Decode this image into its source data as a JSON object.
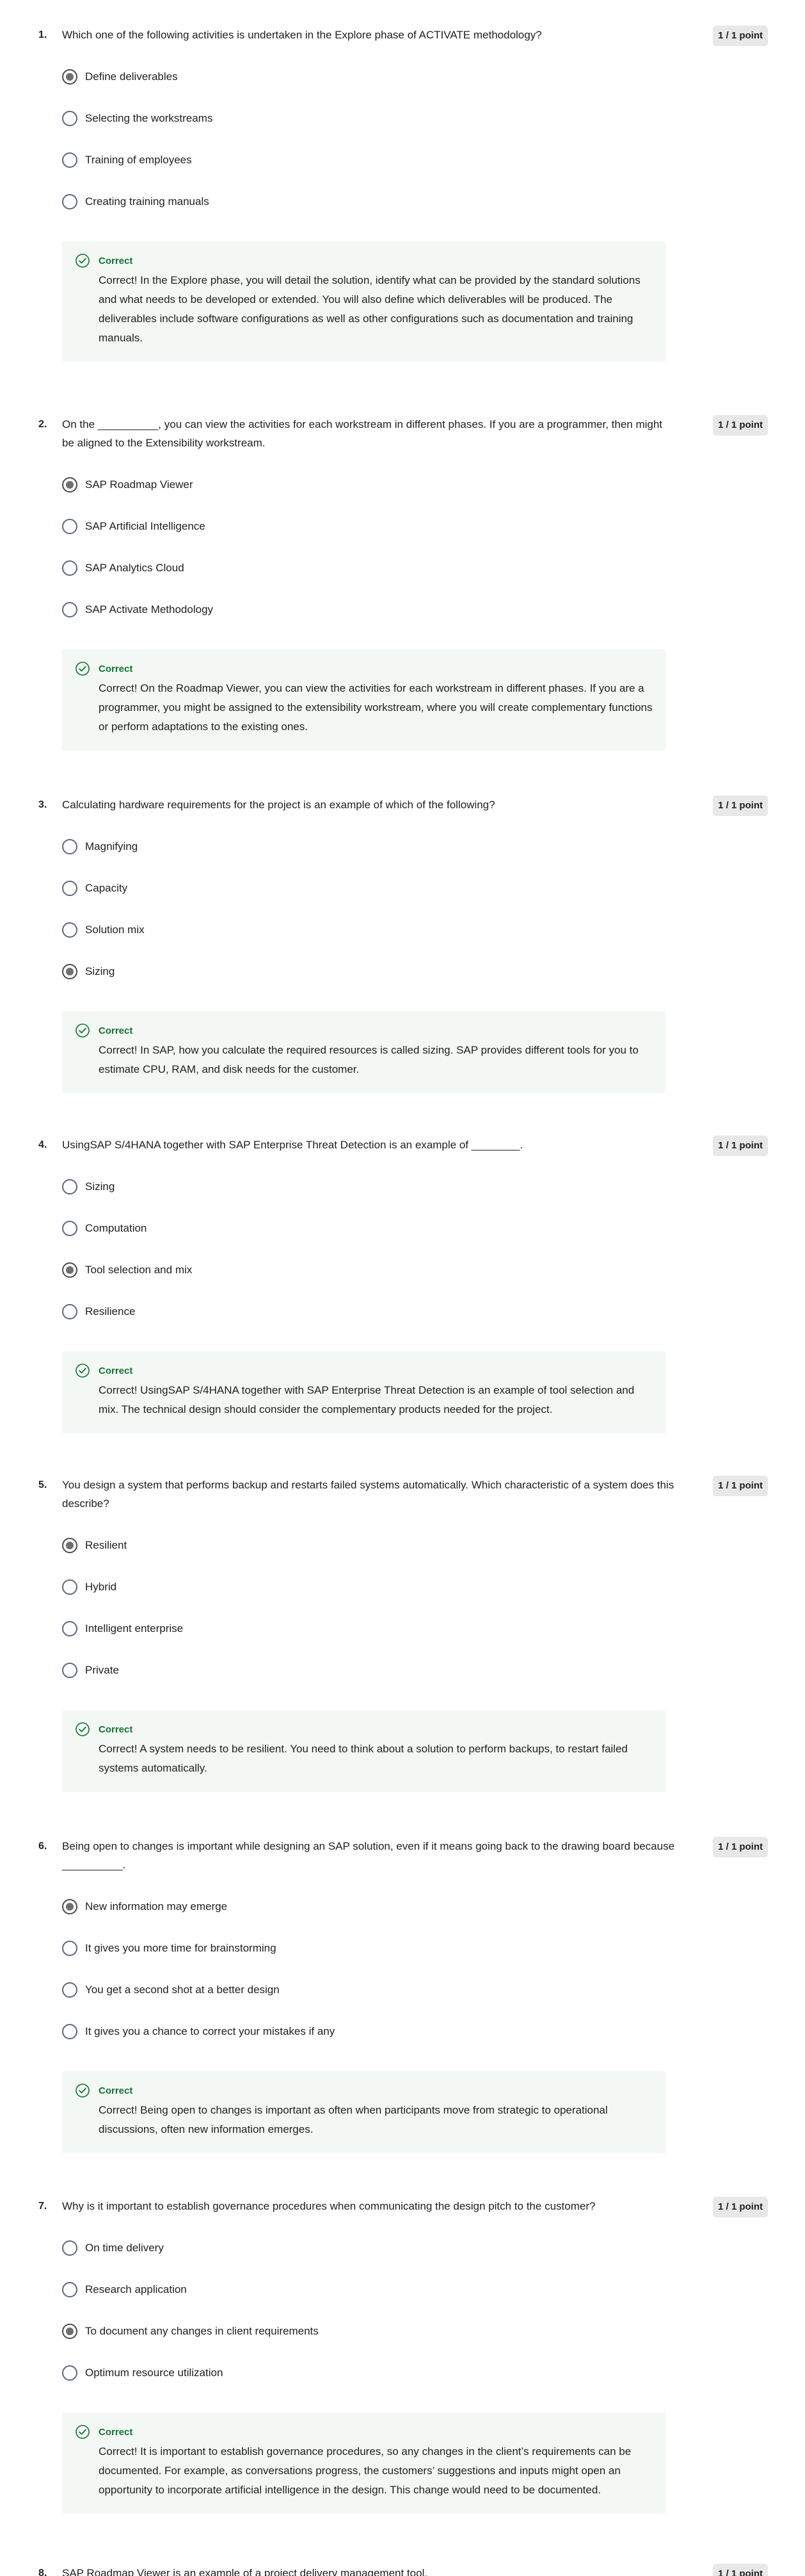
{
  "questions": [
    {
      "number": "1.",
      "text": "Which one of the following activities is undertaken in the Explore phase of ACTIVATE methodology?",
      "points": "1 / 1 point",
      "options": [
        "Define deliverables",
        "Selecting the workstreams",
        "Training of employees",
        "Creating training manuals"
      ],
      "selected": 0,
      "feedback_title": "Correct",
      "feedback_text": "Correct! In the Explore phase, you will detail the solution, identify what can be provided by the standard solutions and what needs to be developed or extended. You will also define which deliverables will be produced. The deliverables include software configurations as well as other configurations such as documentation and training manuals."
    },
    {
      "number": "2.",
      "text": "On the __________, you can view the activities for each workstream in different phases. If you are a programmer, then might be aligned to the Extensibility workstream.",
      "points": "1 / 1 point",
      "options": [
        "SAP Roadmap Viewer",
        "SAP Artificial Intelligence",
        "SAP Analytics Cloud",
        "SAP Activate Methodology"
      ],
      "selected": 0,
      "feedback_title": "Correct",
      "feedback_text": "Correct! On the Roadmap Viewer, you can view the activities for each workstream in different phases. If you are a programmer, you might be assigned to the extensibility workstream, where you will create complementary functions or perform adaptations to the existing ones."
    },
    {
      "number": "3.",
      "text": "Calculating hardware requirements for the project is an example of which of the following?",
      "points": "1 / 1 point",
      "options": [
        "Magnifying",
        "Capacity",
        "Solution mix",
        "Sizing"
      ],
      "selected": 3,
      "feedback_title": "Correct",
      "feedback_text": "Correct! In SAP, how you calculate the required resources is called sizing. SAP provides different tools for you to estimate CPU, RAM, and disk needs for the customer."
    },
    {
      "number": "4.",
      "text": "UsingSAP S/4HANA together with SAP Enterprise Threat Detection is an example of ________.",
      "points": "1 / 1 point",
      "options": [
        "Sizing",
        "Computation",
        "Tool selection and mix",
        "Resilience"
      ],
      "selected": 2,
      "feedback_title": "Correct",
      "feedback_text": "Correct! UsingSAP S/4HANA together with SAP Enterprise Threat Detection is an example of tool selection and mix. The technical design should consider the complementary products needed for the project."
    },
    {
      "number": "5.",
      "text": "You design a system that performs backup and restarts failed systems automatically. Which characteristic of a system does this describe?",
      "points": "1 / 1 point",
      "options": [
        "Resilient",
        "Hybrid",
        "Intelligent enterprise",
        "Private"
      ],
      "selected": 0,
      "feedback_title": "Correct",
      "feedback_text": "Correct! A system needs to be resilient. You need to think about a solution to perform backups, to restart failed systems automatically."
    },
    {
      "number": "6.",
      "text": "Being open to changes is important while designing an SAP solution, even if it means going back to the drawing board because __________.",
      "points": "1 / 1 point",
      "options": [
        "New information may emerge",
        "It gives you more time for brainstorming",
        "You get a second shot at a better design",
        "It gives you a chance to correct your mistakes if any"
      ],
      "selected": 0,
      "feedback_title": "Correct",
      "feedback_text": "Correct! Being open to changes is important as often when participants move from strategic to operational discussions, often new information emerges."
    },
    {
      "number": "7.",
      "text": "Why is it important to establish governance procedures when communicating the design pitch to the customer?",
      "points": "1 / 1 point",
      "options": [
        "On time delivery",
        "Research application",
        "To document any changes in client requirements",
        "Optimum resource utilization"
      ],
      "selected": 2,
      "feedback_title": "Correct",
      "feedback_text": "Correct! It is important to establish governance procedures, so any changes in the client’s requirements can be documented. For example, as conversations progress, the customers’ suggestions and inputs might open an opportunity to incorporate artificial intelligence in the design. This change would need to be documented."
    },
    {
      "number": "8.",
      "text": "SAP Roadmap Viewer is an example of a project delivery management tool.",
      "points": "1 / 1 point",
      "options": [],
      "selected": -1,
      "feedback_title": "",
      "feedback_text": ""
    }
  ],
  "colors": {
    "correct": "#137333",
    "feedback_bg": "#f3f8f4",
    "points_bg": "#e8e8e8"
  },
  "icons": {
    "feedback": "check-circle-icon"
  }
}
